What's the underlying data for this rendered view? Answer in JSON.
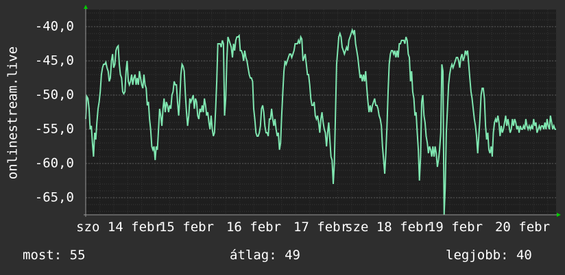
{
  "chart_data": {
    "type": "line",
    "title": "",
    "ylabel": "onlinestream.live",
    "xlabel": "",
    "ylim": [
      -67.5,
      -37.5
    ],
    "grid": true,
    "y_ticks": [
      -40,
      -45,
      -50,
      -55,
      -60,
      -65
    ],
    "y_tick_labels": [
      "-40,0",
      "-45,0",
      "-50,0",
      "-55,0",
      "-60,0",
      "-65,0"
    ],
    "x_tick_labels": [
      "szo 14 febr",
      "15 febr",
      "16 febr",
      "17 febr",
      "sze 18 febr",
      "19 febr",
      "20 febr"
    ],
    "colors": {
      "background": "#2e2e2e",
      "plot_background": "#1e1e1e",
      "grid": "#4a4a4a",
      "line": "#7fe6b0",
      "axis_arrow": "#00cc00"
    },
    "series": [
      {
        "x": [
          0.0,
          0.02,
          0.04,
          0.06,
          0.08,
          0.1,
          0.12,
          0.14,
          0.16,
          0.18,
          0.2,
          0.22,
          0.24,
          0.26,
          0.28,
          0.3,
          0.32,
          0.34,
          0.36,
          0.38,
          0.4,
          0.42,
          0.44,
          0.46,
          0.48,
          0.5,
          0.52,
          0.54,
          0.56,
          0.58,
          0.6,
          0.62,
          0.64,
          0.66,
          0.68,
          0.7,
          0.72,
          0.74,
          0.76,
          0.78,
          0.8,
          0.82,
          0.84,
          0.86,
          0.88,
          0.9,
          0.92,
          0.94,
          0.96,
          0.98,
          1.0,
          1.02,
          1.04,
          1.06,
          1.08,
          1.1,
          1.12,
          1.14,
          1.16,
          1.18,
          1.2,
          1.22,
          1.24,
          1.26,
          1.28,
          1.3,
          1.32,
          1.34,
          1.36,
          1.38,
          1.4,
          1.42,
          1.44,
          1.46,
          1.48,
          1.5,
          1.52,
          1.54,
          1.56,
          1.58,
          1.6,
          1.62,
          1.64,
          1.66,
          1.68,
          1.7,
          1.72,
          1.74,
          1.76,
          1.78,
          1.8,
          1.82,
          1.84,
          1.86,
          1.88,
          1.9,
          1.92,
          1.94,
          1.96,
          1.98,
          2.0,
          2.02,
          2.04,
          2.06,
          2.08,
          2.1,
          2.12,
          2.14,
          2.16,
          2.18,
          2.2,
          2.22,
          2.24,
          2.26,
          2.28,
          2.3,
          2.32,
          2.34,
          2.36,
          2.38,
          2.4,
          2.42,
          2.44,
          2.46,
          2.48,
          2.5,
          2.52,
          2.54,
          2.56,
          2.58,
          2.6,
          2.62,
          2.64,
          2.66,
          2.68,
          2.7,
          2.72,
          2.74,
          2.76,
          2.78,
          2.8,
          2.82,
          2.84,
          2.86,
          2.88,
          2.9,
          2.92,
          2.94,
          2.96,
          2.98,
          3.0,
          3.02,
          3.04,
          3.06,
          3.08,
          3.1,
          3.12,
          3.14,
          3.16,
          3.18,
          3.2,
          3.22,
          3.24,
          3.26,
          3.28,
          3.3,
          3.32,
          3.34,
          3.36,
          3.38,
          3.4,
          3.42,
          3.44,
          3.46,
          3.48,
          3.5,
          3.52,
          3.54,
          3.56,
          3.58,
          3.6,
          3.62,
          3.64,
          3.66,
          3.68,
          3.7,
          3.72,
          3.74,
          3.76,
          3.78,
          3.8,
          3.82,
          3.84,
          3.86,
          3.88,
          3.9,
          3.92,
          3.94,
          3.96,
          3.98,
          4.0,
          4.02,
          4.04,
          4.06,
          4.08,
          4.1,
          4.12,
          4.14,
          4.16,
          4.18,
          4.2,
          4.22,
          4.24,
          4.26,
          4.28,
          4.3,
          4.32,
          4.34,
          4.36,
          4.38,
          4.4,
          4.42,
          4.44,
          4.46,
          4.48,
          4.5,
          4.52,
          4.54,
          4.56,
          4.58,
          4.6,
          4.62,
          4.64,
          4.66,
          4.68,
          4.7,
          4.72,
          4.74,
          4.76,
          4.78,
          4.8,
          4.82,
          4.84,
          4.86,
          4.88,
          4.9,
          4.92,
          4.94,
          4.96,
          4.98,
          5.0,
          5.02,
          5.04,
          5.06,
          5.08,
          5.1,
          5.12,
          5.14,
          5.16,
          5.18,
          5.2,
          5.22,
          5.24,
          5.26,
          5.28,
          5.3,
          5.32,
          5.34,
          5.36,
          5.38,
          5.4,
          5.42,
          5.44,
          5.46,
          5.48,
          5.5,
          5.52,
          5.54,
          5.56,
          5.58,
          5.6,
          5.62,
          5.64,
          5.66,
          5.68,
          5.7,
          5.72,
          5.74,
          5.76,
          5.78,
          5.8,
          5.82,
          5.84,
          5.86,
          5.88,
          5.9,
          5.92,
          5.94,
          5.96,
          5.98,
          6.0,
          6.02,
          6.04,
          6.06,
          6.08,
          6.1,
          6.12,
          6.14,
          6.16,
          6.18,
          6.2,
          6.22,
          6.24,
          6.26,
          6.28,
          6.3,
          6.32,
          6.34,
          6.36,
          6.38,
          6.4,
          6.42,
          6.44,
          6.46,
          6.48,
          6.5,
          6.52,
          6.54,
          6.56,
          6.58,
          6.6,
          6.62,
          6.64,
          6.66,
          6.68,
          6.7,
          6.72,
          6.74,
          6.76,
          6.78,
          6.8,
          6.82,
          6.84,
          6.86,
          6.88,
          6.9,
          6.92,
          6.94,
          6.96,
          6.98,
          7.0,
          7.02,
          7.04,
          7.06,
          7.08,
          7.1,
          7.12,
          7.14,
          7.16,
          7.18,
          7.2,
          7.22,
          7.24,
          7.26,
          7.28,
          7.3,
          7.32,
          7.34,
          7.36,
          7.38,
          7.4,
          7.42,
          7.44,
          7.46,
          7.48,
          7.5,
          7.52,
          7.54,
          7.56,
          7.58,
          7.6,
          7.62,
          7.64,
          7.66,
          7.68,
          7.7,
          7.72,
          7.74,
          7.76,
          7.78,
          7.8,
          7.82,
          7.84,
          7.86,
          7.88,
          7.9,
          7.92,
          7.94,
          7.96,
          7.98,
          8.0,
          8.02,
          8.04,
          8.06,
          8.08,
          8.1,
          8.12,
          8.14,
          8.16,
          8.18,
          8.2,
          8.22,
          8.24,
          8.26,
          8.28,
          8.3,
          8.32,
          8.34,
          8.36,
          8.38,
          8.4
        ],
        "values": [
          -53.5,
          -50.2,
          -50.5,
          -52.0,
          -55.0,
          -54.5,
          -57.0,
          -59.0,
          -55.5,
          -56.5,
          -54.0,
          -52.0,
          -51.0,
          -49.5,
          -47.0,
          -46.0,
          -45.5,
          -45.5,
          -45.2,
          -46.0,
          -46.5,
          -48.0,
          -47.5,
          -45.0,
          -44.0,
          -46.0,
          -45.5,
          -43.5,
          -43.0,
          -42.8,
          -45.5,
          -47.0,
          -47.5,
          -49.5,
          -49.8,
          -49.5,
          -46.5,
          -45.0,
          -48.0,
          -48.5,
          -48.0,
          -47.0,
          -48.5,
          -47.5,
          -47.0,
          -48.5,
          -47.5,
          -48.5,
          -46.5,
          -47.5,
          -48.5,
          -49.0,
          -47.0,
          -48.5,
          -49.0,
          -51.5,
          -51.0,
          -53.5,
          -55.0,
          -57.5,
          -58.0,
          -57.5,
          -59.5,
          -57.5,
          -58.0,
          -55.0,
          -52.0,
          -53.0,
          -54.5,
          -52.0,
          -50.5,
          -52.5,
          -51.0,
          -51.5,
          -52.5,
          -51.5,
          -52.0,
          -50.0,
          -49.5,
          -48.0,
          -48.5,
          -48.5,
          -51.0,
          -53.0,
          -50.5,
          -47.0,
          -45.5,
          -45.8,
          -46.5,
          -50.0,
          -52.5,
          -54.5,
          -53.0,
          -50.5,
          -51.0,
          -50.5,
          -50.0,
          -52.0,
          -50.5,
          -51.0,
          -53.0,
          -53.5,
          -52.0,
          -52.5,
          -51.5,
          -52.5,
          -50.5,
          -51.5,
          -53.0,
          -52.5,
          -54.0,
          -55.0,
          -53.0,
          -55.0,
          -56.0,
          -55.5,
          -52.0,
          -48.0,
          -42.5,
          -42.5,
          -42.5,
          -43.0,
          -42.0,
          -42.5,
          -53.0,
          -50.5,
          -45.0,
          -41.5,
          -42.0,
          -42.5,
          -43.0,
          -44.5,
          -42.5,
          -43.5,
          -42.0,
          -41.5,
          -41.5,
          -41.3,
          -43.5,
          -43.5,
          -44.0,
          -45.0,
          -43.5,
          -44.5,
          -45.0,
          -46.0,
          -47.0,
          -47.5,
          -47.5,
          -48.0,
          -52.0,
          -53.5,
          -55.5,
          -56.0,
          -56.0,
          -55.5,
          -54.5,
          -52.0,
          -51.5,
          -52.5,
          -54.5,
          -55.5,
          -55.5,
          -56.0,
          -53.5,
          -53.5,
          -52.0,
          -53.5,
          -54.5,
          -53.5,
          -55.0,
          -56.0,
          -55.5,
          -58.0,
          -57.0,
          -53.0,
          -49.5,
          -46.5,
          -45.0,
          -45.5,
          -45.0,
          -44.5,
          -44.0,
          -44.0,
          -44.5,
          -44.0,
          -43.5,
          -42.5,
          -42.5,
          -42.5,
          -42.0,
          -42.5,
          -41.5,
          -41.8,
          -45.0,
          -44.5,
          -44.0,
          -45.5,
          -47.0,
          -47.0,
          -48.5,
          -50.5,
          -51.5,
          -51.5,
          -51.0,
          -53.0,
          -53.5,
          -53.0,
          -54.0,
          -55.5,
          -53.5,
          -52.5,
          -54.0,
          -55.0,
          -55.5,
          -57.5,
          -55.5,
          -54.0,
          -56.5,
          -59.0,
          -59.5,
          -63.0,
          -60.0,
          -53.0,
          -45.5,
          -43.5,
          -41.5,
          -41.0,
          -41.5,
          -43.0,
          -43.5,
          -44.0,
          -43.5,
          -43.0,
          -43.5,
          -42.0,
          -41.5,
          -41.0,
          -40.5,
          -41.0,
          -40.5,
          -42.5,
          -43.5,
          -44.5,
          -46.0,
          -47.5,
          -47.0,
          -48.0,
          -47.0,
          -48.0,
          -46.5,
          -49.0,
          -51.0,
          -52.5,
          -51.5,
          -52.5,
          -51.5,
          -51.0,
          -50.5,
          -51.5,
          -51.5,
          -52.0,
          -53.0,
          -53.5,
          -54.5,
          -57.5,
          -59.5,
          -61.5,
          -58.5,
          -54.5,
          -49.5,
          -45.5,
          -44.0,
          -43.5,
          -43.5,
          -44.0,
          -43.5,
          -44.5,
          -43.5,
          -44.5,
          -42.5,
          -42.5,
          -42.0,
          -42.0,
          -42.0,
          -42.5,
          -41.5,
          -42.0,
          -44.0,
          -44.5,
          -48.0,
          -46.5,
          -49.5,
          -50.5,
          -53.0,
          -52.5,
          -55.5,
          -58.0,
          -62.5,
          -59.0,
          -51.0,
          -50.0,
          -53.0,
          -54.0,
          -56.0,
          -57.0,
          -58.5,
          -57.5,
          -58.0,
          -59.0,
          -57.5,
          -59.0,
          -57.5,
          -58.5,
          -60.5,
          -59.5,
          -58.0,
          -55.5,
          -45.5,
          -46.5,
          -67.5,
          -63.5,
          -55.5,
          -52.0,
          -48.5,
          -47.0,
          -46.0,
          -45.5,
          -46.0,
          -45.5,
          -45.0,
          -44.5,
          -44.5,
          -45.0,
          -46.0,
          -44.5,
          -44.0,
          -45.0,
          -44.5,
          -43.5,
          -44.0,
          -43.5,
          -45.5,
          -47.5,
          -49.5,
          -50.5,
          -52.0,
          -53.5,
          -54.5,
          -56.0,
          -58.5,
          -56.0,
          -53.5,
          -50.0,
          -49.0,
          -49.0,
          -50.5,
          -54.5,
          -56.5,
          -55.5,
          -58.0,
          -58.5,
          -57.5,
          -59.0,
          -55.5,
          -54.0,
          -53.5,
          -54.0,
          -53.0,
          -54.0,
          -56.0,
          -54.5,
          -55.5,
          -55.0,
          -54.0,
          -53.0,
          -54.5,
          -53.5,
          -54.5,
          -55.5,
          -55.0,
          -53.5,
          -54.5,
          -53.5,
          -54.0,
          -55.0,
          -54.5,
          -55.5,
          -54.5,
          -55.0,
          -55.0,
          -54.5,
          -55.0,
          -53.5,
          -54.5,
          -55.0,
          -54.5,
          -55.0,
          -54.5,
          -55.0,
          -53.5,
          -54.5,
          -54.0,
          -55.5,
          -55.0,
          -54.5,
          -55.0,
          -54.5,
          -54.5,
          -55.0,
          -54.0,
          -55.0,
          -53.5,
          -54.5,
          -55.0,
          -53.0,
          -54.0,
          -55.0,
          -54.5,
          -55.0,
          -55.0
        ]
      }
    ]
  },
  "stats": {
    "current": "most: 55",
    "average": "átlag: 49",
    "best": "legjobb: 40"
  }
}
